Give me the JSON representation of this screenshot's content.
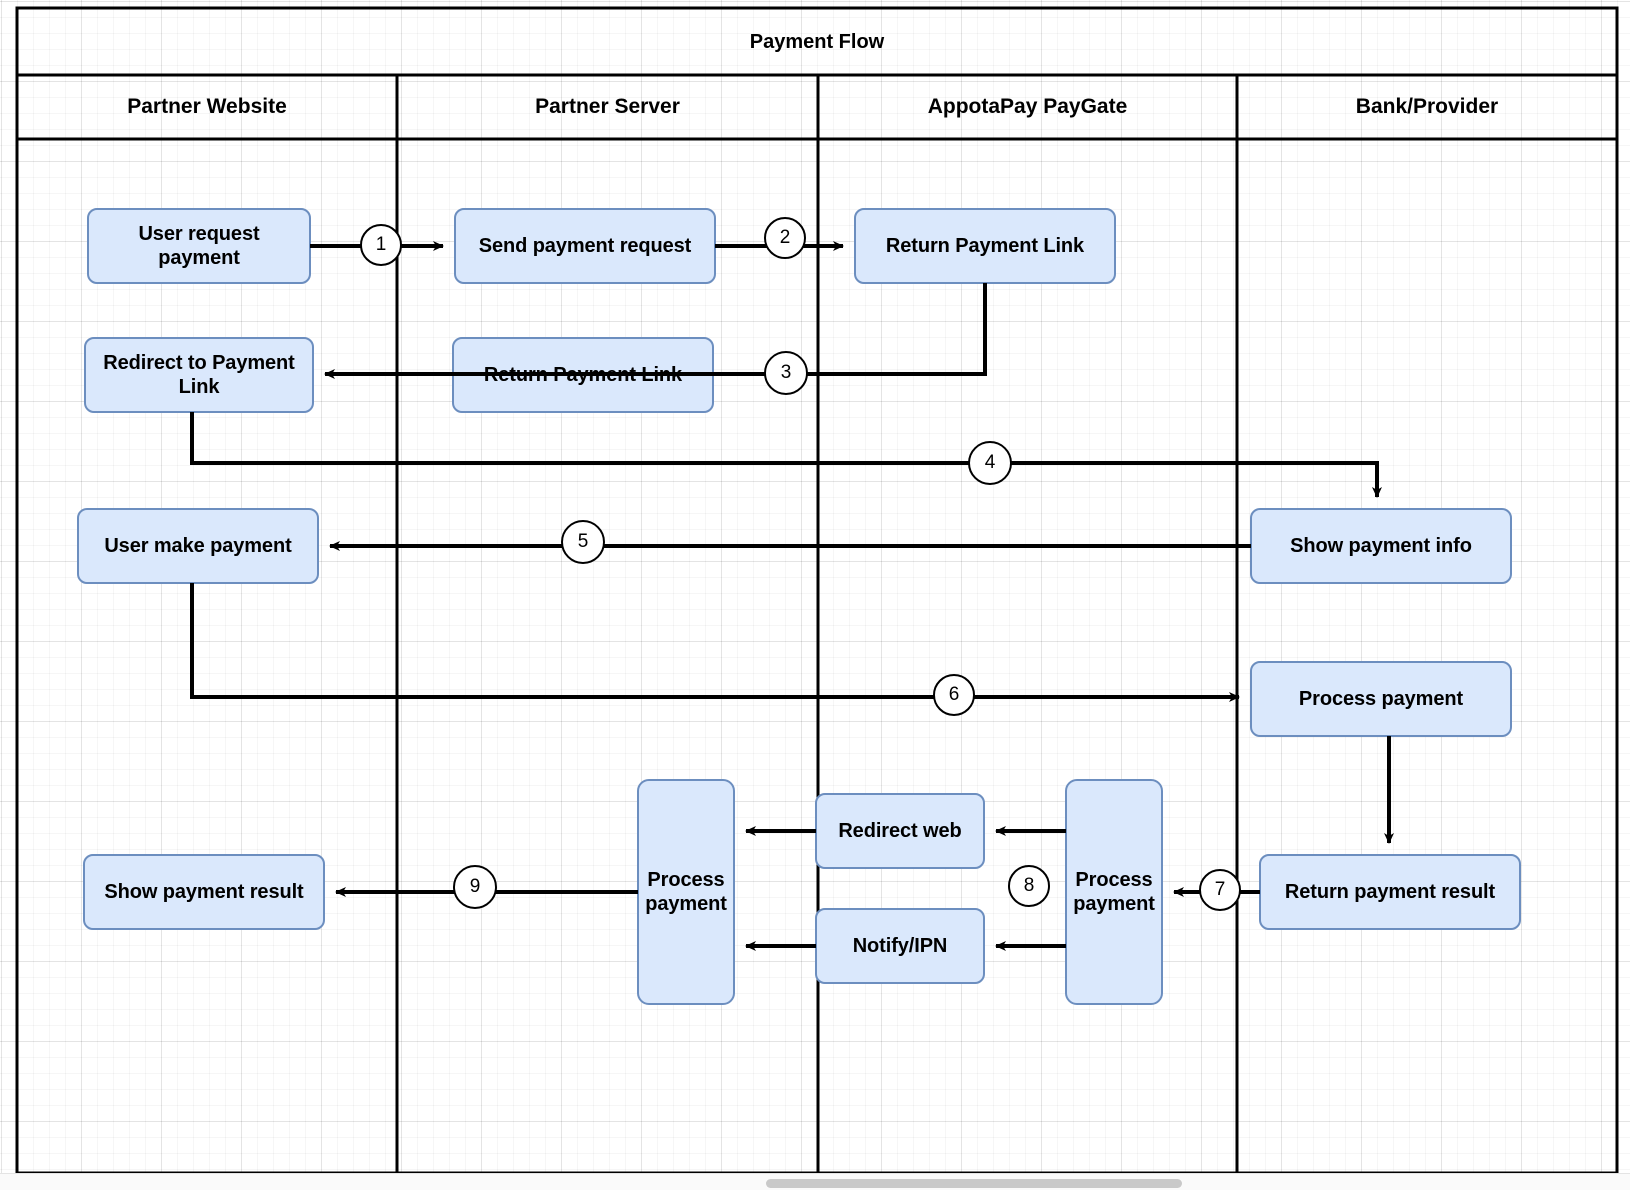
{
  "diagram": {
    "title": "Payment Flow",
    "lanes": [
      {
        "id": "partner-website",
        "label": "Partner Website"
      },
      {
        "id": "partner-server",
        "label": "Partner Server"
      },
      {
        "id": "appotapay-paygate",
        "label": "AppotaPay PayGate"
      },
      {
        "id": "bank-provider",
        "label": "Bank/Provider"
      }
    ],
    "nodes": [
      {
        "id": "user-request-payment",
        "label": "User request payment",
        "lane": "partner-website"
      },
      {
        "id": "send-payment-request",
        "label": "Send payment request",
        "lane": "partner-server"
      },
      {
        "id": "return-payment-link-gate",
        "label": "Return Payment Link",
        "lane": "appotapay-paygate"
      },
      {
        "id": "redirect-to-payment-link",
        "label": "Redirect to Payment Link",
        "lane": "partner-website"
      },
      {
        "id": "return-payment-link-srv",
        "label": "Return Payment Link",
        "lane": "partner-server"
      },
      {
        "id": "show-payment-info",
        "label": "Show payment info",
        "lane": "bank-provider"
      },
      {
        "id": "user-make-payment",
        "label": "User make payment",
        "lane": "partner-website"
      },
      {
        "id": "process-payment-bank",
        "label": "Process payment",
        "lane": "bank-provider"
      },
      {
        "id": "return-payment-result",
        "label": "Return payment result",
        "lane": "bank-provider"
      },
      {
        "id": "process-payment-gate",
        "label": "Process payment",
        "lane": "appotapay-paygate"
      },
      {
        "id": "redirect-web",
        "label": "Redirect web",
        "lane": "appotapay-paygate"
      },
      {
        "id": "notify-ipn",
        "label": "Notify/IPN",
        "lane": "appotapay-paygate"
      },
      {
        "id": "process-payment-srv",
        "label": "Process payment",
        "lane": "partner-server"
      },
      {
        "id": "show-payment-result",
        "label": "Show payment result",
        "lane": "partner-website"
      }
    ],
    "steps": [
      {
        "n": "1",
        "from": "user-request-payment",
        "to": "send-payment-request"
      },
      {
        "n": "2",
        "from": "send-payment-request",
        "to": "return-payment-link-gate"
      },
      {
        "n": "3",
        "from": "return-payment-link-gate",
        "to": "redirect-to-payment-link"
      },
      {
        "n": "4",
        "from": "redirect-to-payment-link",
        "to": "show-payment-info"
      },
      {
        "n": "5",
        "from": "show-payment-info",
        "to": "user-make-payment"
      },
      {
        "n": "6",
        "from": "user-make-payment",
        "to": "process-payment-bank"
      },
      {
        "n": "7",
        "from": "return-payment-result",
        "to": "process-payment-gate"
      },
      {
        "n": "8",
        "from": "process-payment-gate",
        "to": "redirect-web"
      },
      {
        "n": "9",
        "from": "process-payment-srv",
        "to": "show-payment-result"
      }
    ],
    "colors": {
      "node_fill": "#dae8fc",
      "node_stroke": "#6c8ebf",
      "edge": "#000000",
      "pool_border": "#000000",
      "canvas": "#ffffff"
    }
  }
}
